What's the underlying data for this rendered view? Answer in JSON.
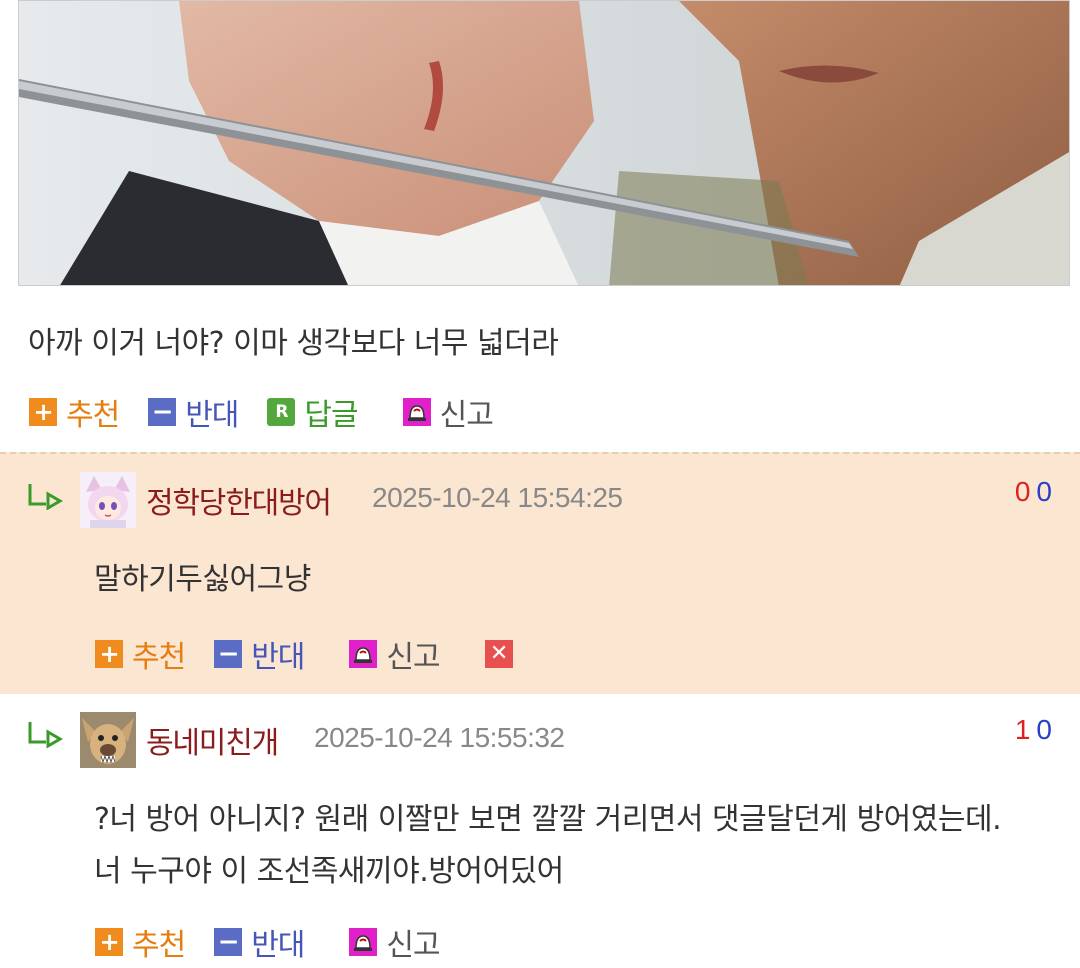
{
  "post": {
    "text": "아까 이거 너야? 이마 생각보다 너무 넓더라",
    "actions": {
      "recommend": "추천",
      "oppose": "반대",
      "reply": "답글",
      "report": "신고"
    }
  },
  "comments": [
    {
      "nickname": "정학당한대방어",
      "date": "2025-10-24 15:54:25",
      "up": "0",
      "down": "0",
      "body": [
        "말하기두싫어그냥"
      ],
      "actions": {
        "recommend": "추천",
        "oppose": "반대",
        "report": "신고"
      },
      "highlighted": true,
      "avatar": "anime-girl-avatar"
    },
    {
      "nickname": "동네미친개",
      "date": "2025-10-24 15:55:32",
      "up": "1",
      "down": "0",
      "body": [
        "?너 방어 아니지? 원래 이짤만 보면 깔깔 거리면서 댓글달던게 방어였는데.",
        "너 누구야 이 조선족새끼야.방어어딨어"
      ],
      "actions": {
        "recommend": "추천",
        "oppose": "반대",
        "report": "신고"
      },
      "highlighted": false,
      "avatar": "dog-avatar"
    }
  ],
  "icons": {
    "recommend": "plus-icon",
    "oppose": "minus-icon",
    "reply": "reply-r-icon",
    "report": "siren-icon",
    "delete": "close-icon",
    "reply_arrow": "reply-arrow-icon"
  },
  "colors": {
    "recommend": "#f08c1e",
    "oppose": "#5a6cc4",
    "reply": "#52a83c",
    "report": "#e020c8",
    "delete": "#e85050",
    "nickname": "#8a1c1c",
    "highlight_bg": "#fbe6d2"
  }
}
